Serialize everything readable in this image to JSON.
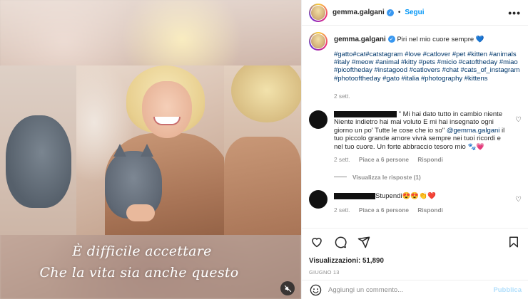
{
  "media": {
    "caption_line1": "È difficile accettare",
    "caption_line2": "Che la vita sia anche questo"
  },
  "header": {
    "username": "gemma.galgani",
    "dot": "•",
    "follow_label": "Segui",
    "more_label": "•••"
  },
  "post": {
    "username": "gemma.galgani",
    "text": "Piri nel mio cuore sempre 💙",
    "hashtags": "#gatto#cat#catstagram #love #catlover #pet #kitten #animals #italy #meow #animal #kitty #pets #micio #catoftheday #miao #picoftheday #instagood #catlovers #chat #cats_of_instagram #photooftheday #gato #italia #photography #kittens",
    "time": "2 sett."
  },
  "comments": [
    {
      "text_pre": "\" Mi hai dato tutto in cambio niente Niente indietro hai mai voluto E mi hai insegnato ogni giorno un po' Tutte le cose che io so\" ",
      "mention": "@gemma.galgani",
      "text_post": " il tuo piccolo grande amore vivrà sempre nei tuoi ricordi e nel tuo cuore. Un forte abbraccio tesoro mio 🐾💗",
      "time": "2 sett.",
      "likes": "Piace a 6 persone",
      "reply": "Rispondi",
      "view_replies": "Visualizza le risposte (1)"
    },
    {
      "text_pre": "Stupendi😍😍👏❤️",
      "time": "2 sett.",
      "likes": "Piace a 6 persone",
      "reply": "Rispondi"
    }
  ],
  "actions": {
    "views_label": "Visualizzazioni:",
    "views_count": "51,890",
    "date": "GIUGNO 13"
  },
  "add_comment": {
    "placeholder": "Aggiungi un commento...",
    "publish": "Pubblica"
  },
  "colors": {
    "accent": "#0095f6",
    "link": "#00376b",
    "verified": "#3897f0",
    "publish_disabled": "#b2dffc"
  },
  "icons": {
    "verified": "verified-badge-icon",
    "heart": "heart-icon",
    "comment": "comment-icon",
    "share": "share-icon",
    "save": "bookmark-icon",
    "emoji": "emoji-icon",
    "mute": "mute-icon"
  }
}
